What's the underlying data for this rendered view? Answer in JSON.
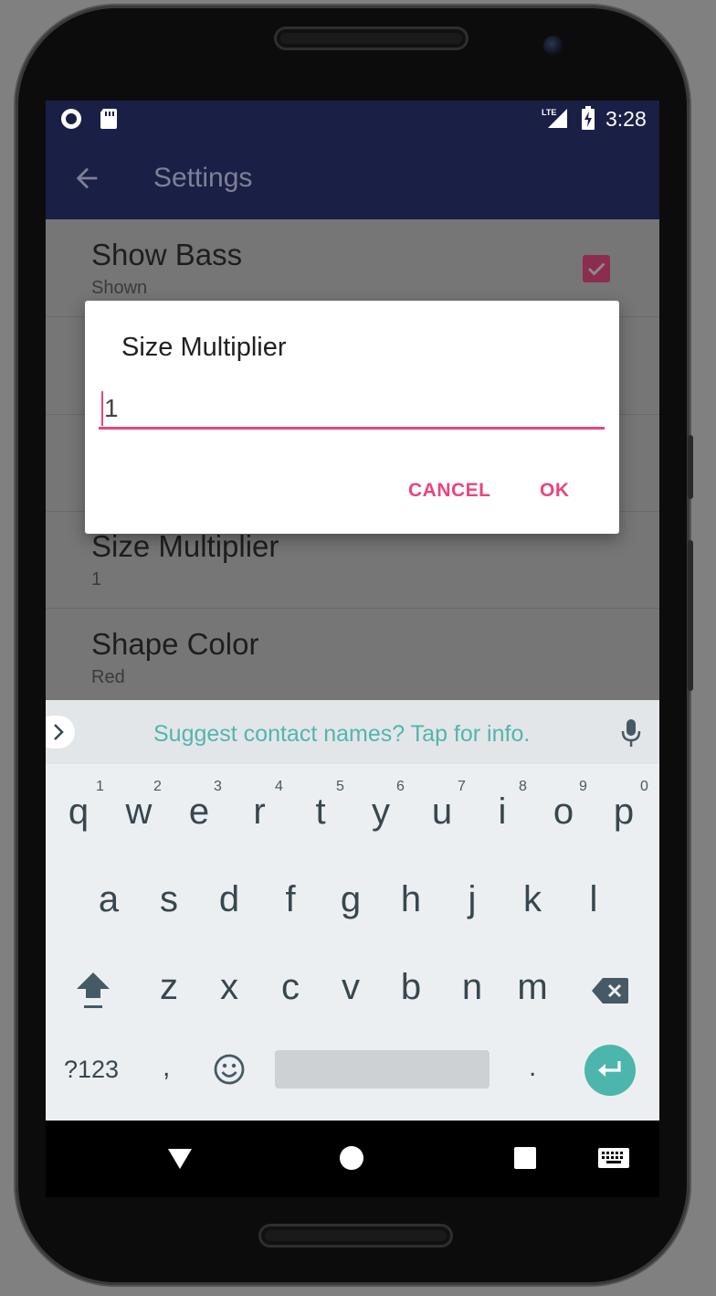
{
  "status_bar": {
    "time": "3:28",
    "network": "LTE",
    "left_icons": [
      "circle-notification-icon",
      "sd-card-icon"
    ],
    "right_icons": [
      "lte-signal-icon",
      "battery-charging-icon"
    ]
  },
  "app_bar": {
    "title": "Settings",
    "back_icon": "back-arrow-icon"
  },
  "preferences": [
    {
      "title": "Show Bass",
      "summary": "Shown",
      "checked": true
    },
    {
      "title": "",
      "summary": ""
    },
    {
      "title": "",
      "summary": ""
    },
    {
      "title": "Size Multiplier",
      "summary": "1"
    },
    {
      "title": "Shape Color",
      "summary": "Red"
    }
  ],
  "dialog": {
    "title": "Size Multiplier",
    "input_value": "1",
    "cancel_label": "CANCEL",
    "ok_label": "OK"
  },
  "keyboard": {
    "suggestion": "Suggest contact names? Tap for info.",
    "row1": [
      {
        "key": "q",
        "hint": "1"
      },
      {
        "key": "w",
        "hint": "2"
      },
      {
        "key": "e",
        "hint": "3"
      },
      {
        "key": "r",
        "hint": "4"
      },
      {
        "key": "t",
        "hint": "5"
      },
      {
        "key": "y",
        "hint": "6"
      },
      {
        "key": "u",
        "hint": "7"
      },
      {
        "key": "i",
        "hint": "8"
      },
      {
        "key": "o",
        "hint": "9"
      },
      {
        "key": "p",
        "hint": "0"
      }
    ],
    "row2": [
      "a",
      "s",
      "d",
      "f",
      "g",
      "h",
      "j",
      "k",
      "l"
    ],
    "row3": [
      "z",
      "x",
      "c",
      "v",
      "b",
      "n",
      "m"
    ],
    "symbols_label": "?123",
    "comma_label": ",",
    "period_label": ".",
    "icons": [
      "chevron-right-icon",
      "microphone-icon",
      "shift-icon",
      "backspace-icon",
      "emoji-icon",
      "enter-icon"
    ]
  },
  "colors": {
    "primary_dark": "#1a1f45",
    "accent": "#e8467c",
    "keyboard_accent": "#4db6ac"
  }
}
